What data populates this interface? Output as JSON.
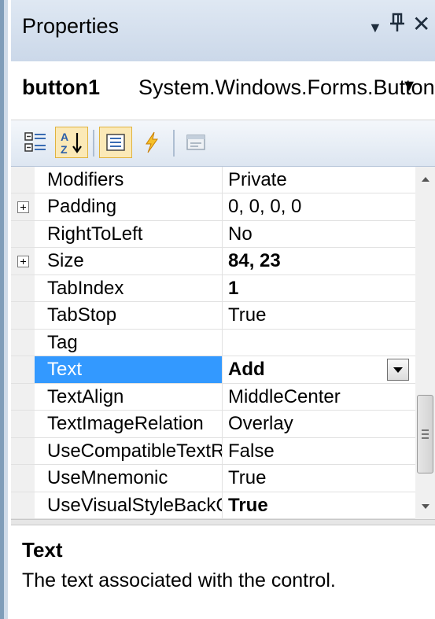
{
  "panel": {
    "title": "Properties",
    "controls": {
      "dropdown_glyph": "▼",
      "pin_glyph": "ᵽ",
      "close_glyph": "✕"
    }
  },
  "selector": {
    "object_name": "button1",
    "object_type": "System.Windows.Forms.Button",
    "dropdown_glyph": "▾"
  },
  "toolbar": {
    "buttons": [
      {
        "icon": "categorized-icon",
        "active": false
      },
      {
        "icon": "alphabetical-icon",
        "active": true
      },
      {
        "icon": "properties-icon",
        "active": true
      },
      {
        "icon": "events-icon",
        "active": false
      },
      {
        "icon": "property-pages-icon",
        "active": false
      }
    ]
  },
  "grid": {
    "rows": [
      {
        "name": "Modifiers",
        "value": "Private",
        "expandable": false,
        "bold": false
      },
      {
        "name": "Padding",
        "value": "0, 0, 0, 0",
        "expandable": true,
        "bold": false
      },
      {
        "name": "RightToLeft",
        "value": "No",
        "expandable": false,
        "bold": false
      },
      {
        "name": "Size",
        "value": "84, 23",
        "expandable": true,
        "bold": true
      },
      {
        "name": "TabIndex",
        "value": "1",
        "expandable": false,
        "bold": true
      },
      {
        "name": "TabStop",
        "value": "True",
        "expandable": false,
        "bold": false
      },
      {
        "name": "Tag",
        "value": "",
        "expandable": false,
        "bold": false
      },
      {
        "name": "Text",
        "value": "Add",
        "expandable": false,
        "bold": true,
        "selected": true
      },
      {
        "name": "TextAlign",
        "value": "MiddleCenter",
        "expandable": false,
        "bold": false
      },
      {
        "name": "TextImageRelation",
        "value": "Overlay",
        "expandable": false,
        "bold": false
      },
      {
        "name": "UseCompatibleTextR",
        "value": "False",
        "expandable": false,
        "bold": false
      },
      {
        "name": "UseMnemonic",
        "value": "True",
        "expandable": false,
        "bold": false
      },
      {
        "name": "UseVisualStyleBackCo",
        "value": "True",
        "expandable": false,
        "bold": true
      }
    ]
  },
  "description": {
    "title": "Text",
    "text": "The text associated with the control."
  },
  "colors": {
    "selection": "#3399ff",
    "header_gradient_top": "#dfe8f3",
    "header_gradient_bottom": "#cbd8e9"
  }
}
